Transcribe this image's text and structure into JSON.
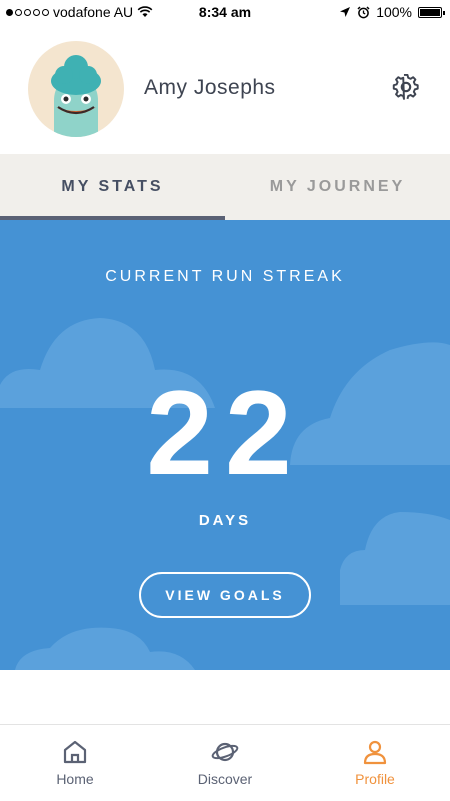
{
  "status_bar": {
    "carrier": "vodafone AU",
    "time": "8:34 am",
    "battery": "100%"
  },
  "profile": {
    "name": "Amy Josephs",
    "avatar_icon": "smiling-character-avatar",
    "settings_icon": "gear-icon"
  },
  "tabs": [
    {
      "label": "MY STATS",
      "active": true
    },
    {
      "label": "MY JOURNEY",
      "active": false
    }
  ],
  "streak": {
    "label": "CURRENT RUN STREAK",
    "value": "22",
    "unit": "DAYS",
    "button_label": "VIEW GOALS",
    "background_color": "#4592d4"
  },
  "bottom_nav": [
    {
      "label": "Home",
      "icon": "home-icon",
      "active": false
    },
    {
      "label": "Discover",
      "icon": "planet-icon",
      "active": false
    },
    {
      "label": "Profile",
      "icon": "person-icon",
      "active": true
    }
  ],
  "colors": {
    "accent": "#f0923d",
    "text_dark": "#3e4451",
    "tab_background": "#f1efeb"
  }
}
